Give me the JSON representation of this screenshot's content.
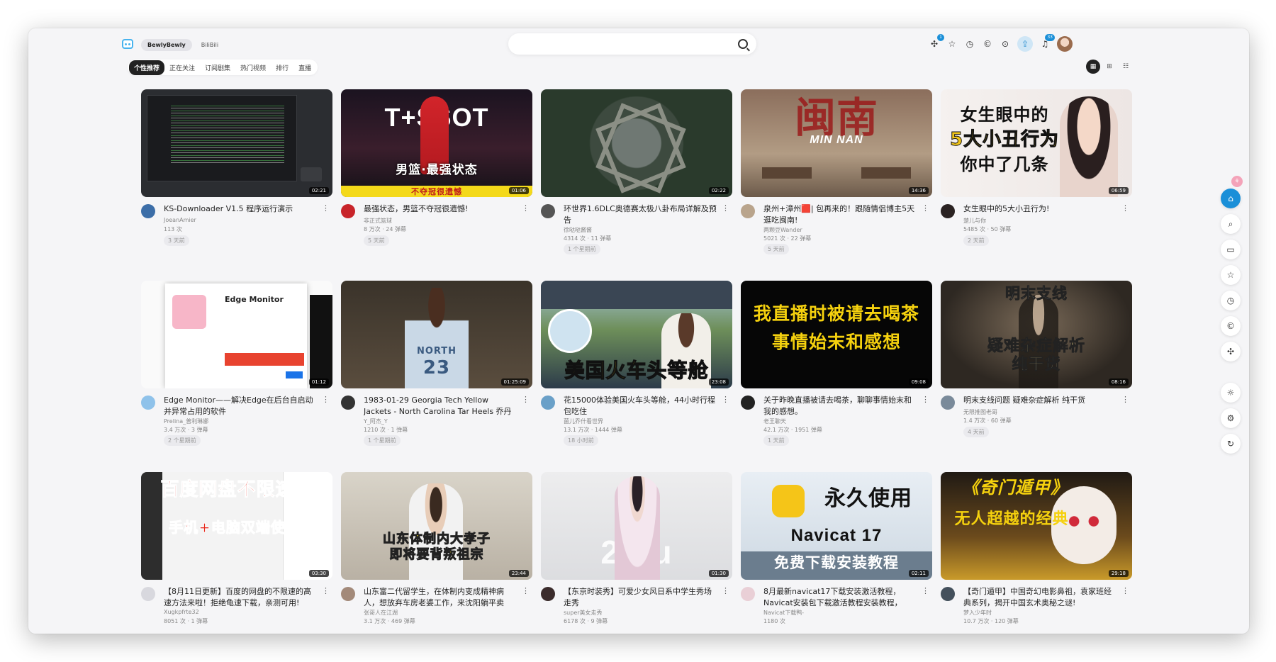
{
  "header": {
    "app_tabs": [
      {
        "label": "BewlyBewly",
        "active": true
      },
      {
        "label": "BiliBili",
        "active": false
      }
    ],
    "search_placeholder": "",
    "badges": {
      "moments": "1",
      "notifications": "33"
    }
  },
  "tabs": [
    {
      "label": "个性推荐",
      "active": true
    },
    {
      "label": "正在关注",
      "active": false
    },
    {
      "label": "订阅剧集",
      "active": false
    },
    {
      "label": "热门视频",
      "active": false
    },
    {
      "label": "排行",
      "active": false
    },
    {
      "label": "直播",
      "active": false
    }
  ],
  "videos": [
    {
      "title": "KS-Downloader V1.5 程序运行演示",
      "author": "JoeanAmier",
      "stats": "113 次",
      "time": "3 天前",
      "duration": "02:21",
      "caption": ""
    },
    {
      "title": "最强状态，男篮不夺冠很遗憾!",
      "author": "非正式篮球",
      "stats": "8 万次 · 24 弹幕",
      "time": "5 天前",
      "duration": "01:06",
      "caption": "男篮·最强状态",
      "caption2": "不夺冠很遗憾",
      "brand": "T+SSOT"
    },
    {
      "title": "环世界1.6DLC奥德赛太极八卦布局详解及预告",
      "author": "徐哒哒酱酱",
      "stats": "4314 次 · 11 弹幕",
      "time": "1 个星期前",
      "duration": "02:22",
      "caption": ""
    },
    {
      "title": "泉州+漳州🟥| 包再来的！跟随情侣博主5天逛吃闽南!",
      "author": "两颗豆Wander",
      "stats": "5021 次 · 22 弹幕",
      "time": "5 天前",
      "duration": "14:36",
      "caption": "闽南",
      "caption2": "MIN NAN"
    },
    {
      "title": "女生眼中的5大小丑行为!",
      "author": "楚儿与你",
      "stats": "5485 次 · 50 弹幕",
      "time": "2 天前",
      "duration": "06:59",
      "caption": "女生眼中的",
      "caption2": "5大小丑行为",
      "caption3": "你中了几条"
    },
    {
      "title": "Edge Monitor——解决Edge在后台自启动并异常占用的软件",
      "author": "Prelina_普利琳娜",
      "stats": "3.4 万次 · 3 弹幕",
      "time": "2 个星期前",
      "duration": "01:12",
      "caption": "Edge Monitor"
    },
    {
      "title": "1983-01-29 Georgia Tech Yellow Jackets - North Carolina Tar Heels 乔丹欧大学...",
      "author": "Y_阿杰_Y",
      "stats": "1210 次 · 1 弹幕",
      "time": "1 个星期前",
      "duration": "01:25:09",
      "caption": "NORTH",
      "caption2": "23"
    },
    {
      "title": "花15000体验美国火车头等舱，44小时行程包吃住",
      "author": "菌儿乔什看世界",
      "stats": "13.1 万次 · 1444 弹幕",
      "time": "18 小时前",
      "duration": "23:08",
      "caption": "美国火车头等舱"
    },
    {
      "title": "关于昨晚直播被请去喝茶，聊聊事情始末和我的感想。",
      "author": "老王聊天",
      "stats": "42.1 万次 · 1951 弹幕",
      "time": "1 天前",
      "duration": "09:08",
      "caption": "我直播时被请去喝茶",
      "caption2": "事情始末和感想"
    },
    {
      "title": "明末支线问题 疑难杂症解析 纯干货",
      "author": "无限推图老哥",
      "stats": "1.4 万次 · 60 弹幕",
      "time": "4 天前",
      "duration": "08:16",
      "caption": "明末支线",
      "caption2": "疑难杂症解析",
      "caption3": "纯干货"
    },
    {
      "title": "【8月11日更新】百度的网盘的不限速的高速方法来啦！拒绝龟速下载，亲测可用!",
      "author": "Xugkpfrte32",
      "stats": "8051 次 · 1 弹幕",
      "time": "",
      "duration": "03:30",
      "caption": "百度网盘不限速",
      "caption2": "手机+电脑双端使用"
    },
    {
      "title": "山东富二代留学生，在体制内变成精神病人，想放弃车房老婆工作，来沈阳躺平卖烤...",
      "author": "张哥人在江湖",
      "stats": "3.1 万次 · 469 弹幕",
      "time": "",
      "duration": "23:44",
      "caption": "山东体制内大孝子",
      "caption2": "即将要背叛祖宗"
    },
    {
      "title": "【东京时装秀】可爱少女风日系中学生秀场走秀",
      "author": "super美女走秀",
      "stats": "6178 次 · 9 弹幕",
      "time": "",
      "duration": "01:30",
      "caption": "2  Su"
    },
    {
      "title": "8月最新navicat17下载安装激活教程，Navicat安装包下载激活教程安装教程，Navic...",
      "author": "Navicat下载鸭-",
      "stats": "1180 次",
      "time": "",
      "duration": "02:11",
      "caption": "永久使用",
      "caption2": "Navicat 17",
      "caption3": "免费下载安装教程"
    },
    {
      "title": "【奇门遁甲】中国奇幻电影鼻祖，袁家班经典系列，揭开中国玄术奥秘之谜!",
      "author": "梦入少年时",
      "stats": "10.7 万次 · 120 弹幕",
      "time": "",
      "duration": "29:18",
      "caption": "《奇门遁甲》",
      "caption2": "无人超越的经典"
    }
  ],
  "colors": {
    "accent": "#1a8fd8",
    "background": "#f5f5f7"
  }
}
